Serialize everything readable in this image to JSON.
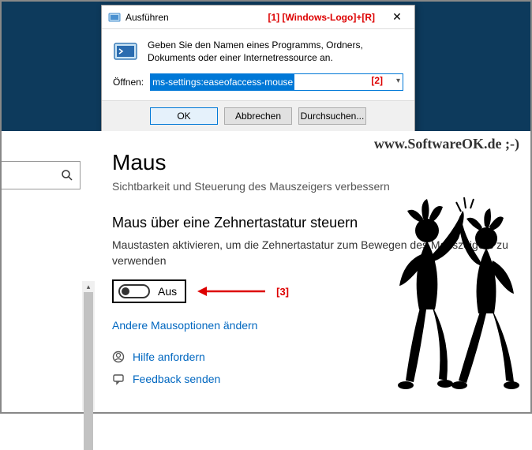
{
  "run": {
    "title": "Ausführen",
    "annotation1": "[1]  [Windows-Logo]+[R]",
    "description": "Geben Sie den Namen eines Programms, Ordners, Dokuments oder einer Internetressource an.",
    "openLabel": "Öffnen:",
    "inputValue": "ms-settings:easeofaccess-mouse",
    "annotation2": "[2]",
    "okLabel": "OK",
    "cancelLabel": "Abbrechen",
    "browseLabel": "Durchsuchen..."
  },
  "watermark": "www.SoftwareOK.de ;-)",
  "settings": {
    "title": "Maus",
    "subtitle": "Sichtbarkeit und Steuerung des Mauszeigers verbessern",
    "sectionHeading": "Maus über eine Zehnertastatur steuern",
    "sectionDesc": "Maustasten aktivieren, um die Zehnertastatur zum Bewegen des Mauszeigers zu verwenden",
    "toggleLabel": "Aus",
    "annotation3": "[3]",
    "otherOptionsLink": "Andere Mausoptionen ändern",
    "helpLabel": "Hilfe anfordern",
    "feedbackLabel": "Feedback senden"
  }
}
